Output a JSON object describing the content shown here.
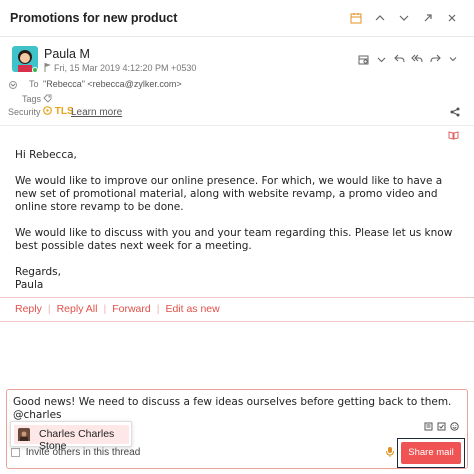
{
  "header": {
    "subject": "Promotions for new product",
    "icons": [
      "calendar-icon",
      "chevron-up-icon",
      "chevron-down-icon",
      "expand-icon",
      "close-icon"
    ]
  },
  "message": {
    "sender": "Paula M",
    "date": "Fri, 15 Mar 2019 4:12:20 PM +0530",
    "to_label": "To",
    "to_value": "\"Rebecca\" <rebecca@zylker.com>",
    "tags_label": "Tags",
    "security_label": "Security",
    "tls": "TLS",
    "learn_more": "Learn more",
    "icons": [
      "archive-icon",
      "chevron-down-icon",
      "reply-icon",
      "reply-all-icon",
      "forward-icon",
      "more-icon"
    ]
  },
  "body": {
    "greeting": "Hi Rebecca,",
    "para1": "We would like to improve our online presence. For which, we would like to have a new set of promotional material, along  with website revamp, a promo video and online store revamp to be done.",
    "para2": "We would like to discuss with you and your team regarding this. Please let us know best possible dates next week for a meeting.",
    "closing": "Regards,",
    "signature": "Paula"
  },
  "actions": {
    "reply": "Reply",
    "reply_all": "Reply All",
    "forward": "Forward",
    "edit_as_new": "Edit as new"
  },
  "composer": {
    "line1": "Good news! We need to discuss a few ideas ourselves before getting back to them.",
    "line2": "@charles",
    "invite_text": "Invite others in this thread",
    "share_button": "Share mail"
  },
  "mention": {
    "name": "Charles Charles Stone"
  },
  "colors": {
    "accent": "#f05353",
    "link_red": "#e0504a",
    "tls": "#e8a417"
  }
}
